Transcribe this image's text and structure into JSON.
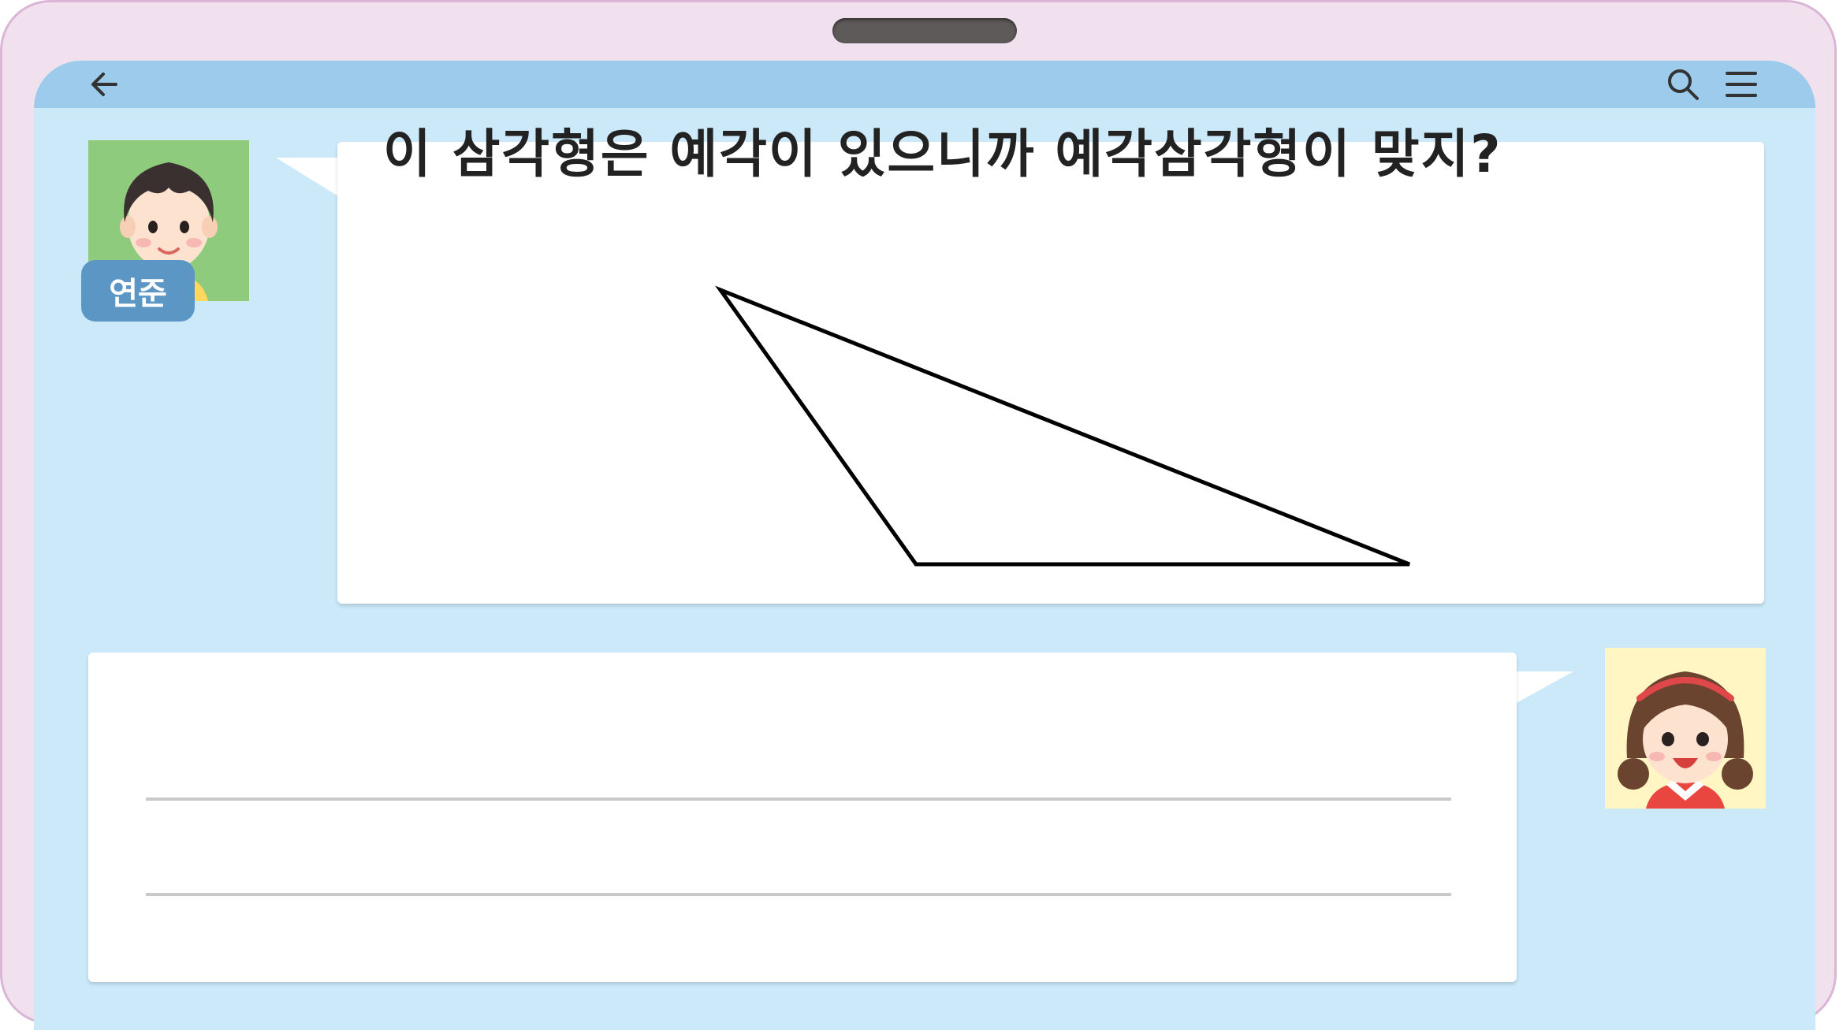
{
  "header": {
    "back_icon": "arrow-left-icon",
    "search_icon": "search-icon",
    "menu_icon": "hamburger-menu-icon"
  },
  "chat": {
    "speaker1": {
      "name": "연준",
      "message": "이 삼각형은 예각이 있으니까 예각삼각형이 맞지?",
      "figure": "obtuse-triangle"
    },
    "speaker2": {
      "answer": ""
    }
  },
  "colors": {
    "frame": "#f1e1ef",
    "topbar": "#9ccbeb",
    "screen": "#cce9fa",
    "badge": "#5b96c5"
  }
}
